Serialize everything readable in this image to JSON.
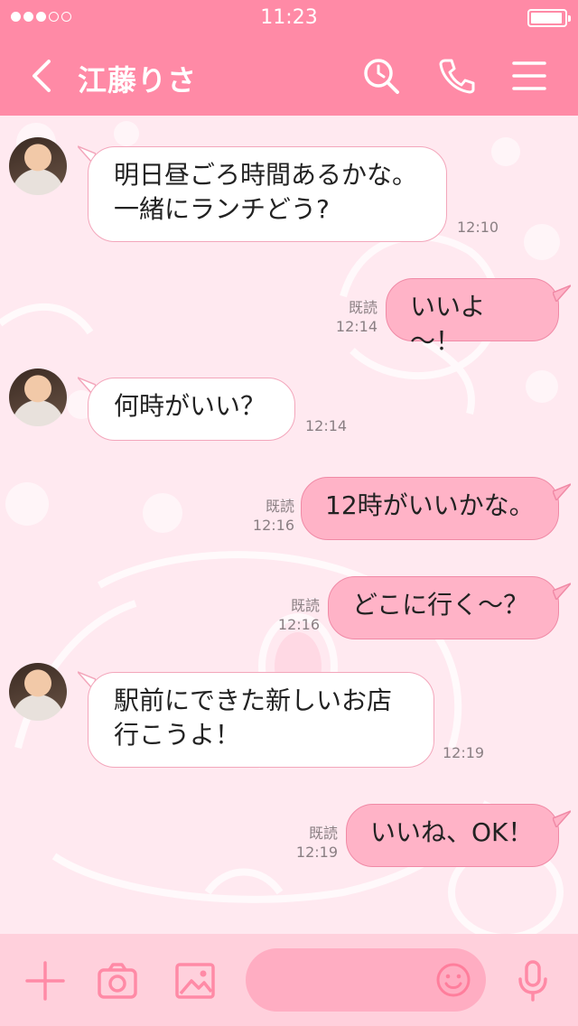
{
  "status_bar": {
    "time": "11:23",
    "signal_dots": [
      true,
      true,
      true,
      false,
      false
    ],
    "battery_level": 0.95
  },
  "header": {
    "contact_name": "江藤りさ",
    "icons": [
      "back-chevron-icon",
      "search-clock-icon",
      "phone-icon",
      "menu-icon"
    ]
  },
  "messages": [
    {
      "side": "in",
      "lines": [
        "明日昼ごろ時間あるかな。",
        "一緒にランチどう?"
      ],
      "time": "12:10"
    },
    {
      "side": "out",
      "lines": [
        "いいよ～！"
      ],
      "read": "既読",
      "time": "12:14"
    },
    {
      "side": "in",
      "lines": [
        "何時がいい？"
      ],
      "time": "12:14"
    },
    {
      "side": "out",
      "lines": [
        "12時がいいかな。"
      ],
      "read": "既読",
      "time": "12:16"
    },
    {
      "side": "out",
      "lines": [
        "どこに行く～？"
      ],
      "read": "既読",
      "time": "12:16"
    },
    {
      "side": "in",
      "lines": [
        "駅前にできた新しいお店",
        "行こうよ！"
      ],
      "time": "12:19"
    },
    {
      "side": "out",
      "lines": [
        "いいね、OK！"
      ],
      "read": "既読",
      "time": "12:19"
    }
  ],
  "footer": {
    "icons": [
      "plus-icon",
      "camera-icon",
      "image-icon",
      "emoji-icon",
      "microphone-icon"
    ],
    "input_placeholder": ""
  },
  "colors": {
    "accent": "#ff8aa6",
    "background": "#ffe9f0",
    "outgoing_bubble": "#ffb3c7",
    "incoming_bubble": "#ffffff"
  }
}
